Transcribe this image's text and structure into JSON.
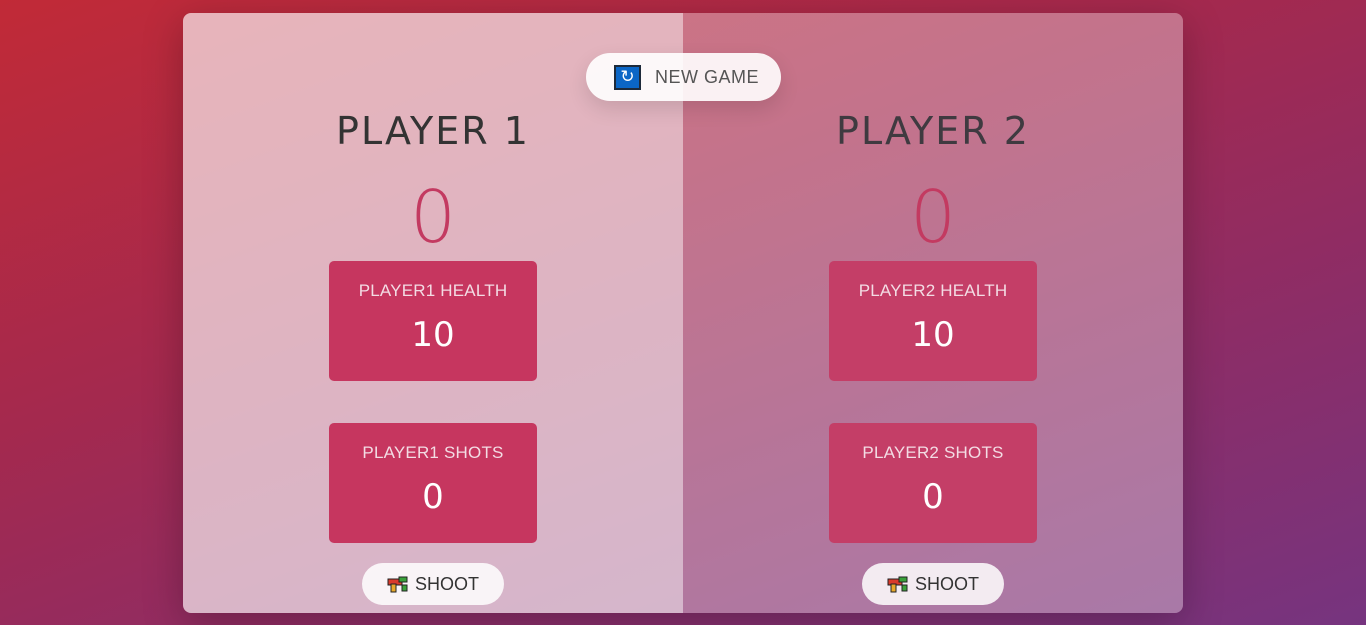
{
  "new_game": {
    "label": "NEW GAME",
    "icon": "refresh-icon"
  },
  "players": [
    {
      "name": "PLAYER 1",
      "score": "0",
      "health_label": "PLAYER1 HEALTH",
      "health_value": "10",
      "shots_label": "PLAYER1 SHOTS",
      "shots_value": "0",
      "shoot_label": "SHOOT",
      "shoot_icon": "gun-icon"
    },
    {
      "name": "PLAYER 2",
      "score": "0",
      "health_label": "PLAYER2 HEALTH",
      "health_value": "10",
      "shots_label": "PLAYER2 SHOTS",
      "shots_value": "0",
      "shoot_label": "SHOOT",
      "shoot_icon": "gun-icon"
    }
  ],
  "colors": {
    "accent": "#c6365f",
    "score": "#c33a61",
    "refresh_icon_bg": "#0b66c6"
  }
}
